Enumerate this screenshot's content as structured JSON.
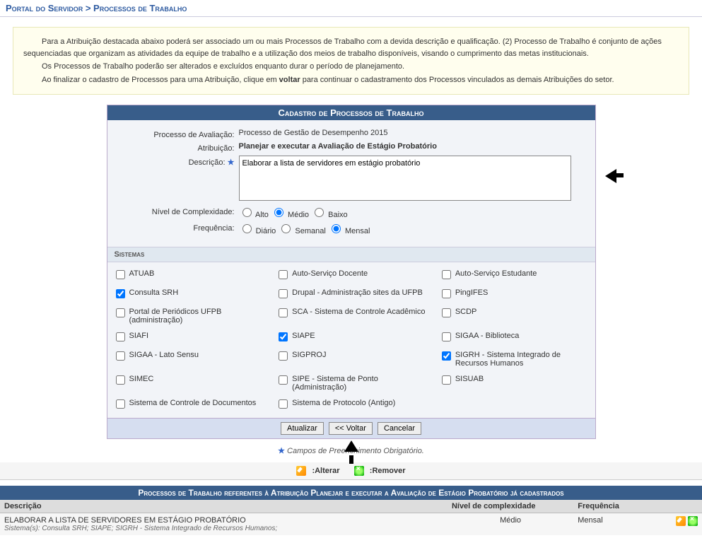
{
  "breadcrumb": "Portal do Servidor > Processos de Trabalho",
  "info": {
    "p1": "Para a Atribuição destacada abaixo poderá ser associado um ou mais Processos de Trabalho com a devida descrição e qualificação. (2) Processo de Trabalho é conjunto de ações sequenciadas que organizam as atividades da equipe de trabalho e a utilização dos meios de trabalho disponíveis, visando o cumprimento das metas institucionais.",
    "p2": "Os Processos de Trabalho poderão ser alterados e excluídos enquanto durar o período de planejamento.",
    "p3_pre": "Ao finalizar o cadastro de Processos para uma Atribuição, clique em ",
    "p3_bold": "voltar",
    "p3_post": " para continuar o cadastramento dos Processos vinculados as demais Atribuições do setor."
  },
  "panel_title": "Cadastro de Processos de Trabalho",
  "labels": {
    "processo": "Processo de Avaliação:",
    "atribuicao": "Atribuição:",
    "descricao": "Descrição:",
    "nivel": "Nível de Complexidade:",
    "frequencia": "Frequência:"
  },
  "values": {
    "processo": "Processo de Gestão de Desempenho 2015",
    "atribuicao": "Planejar e executar a Avaliação de Estágio Probatório",
    "descricao": "Elaborar a lista de servidores em estágio probatório"
  },
  "nivel_opts": {
    "alto": "Alto",
    "medio": "Médio",
    "baixo": "Baixo",
    "selected": "medio"
  },
  "freq_opts": {
    "diario": "Diário",
    "semanal": "Semanal",
    "mensal": "Mensal",
    "selected": "mensal"
  },
  "sistemas_hdr": "Sistemas",
  "sistemas": [
    {
      "label": "ATUAB",
      "checked": false
    },
    {
      "label": "Auto-Serviço Docente",
      "checked": false
    },
    {
      "label": "Auto-Serviço Estudante",
      "checked": false
    },
    {
      "label": "Consulta SRH",
      "checked": true
    },
    {
      "label": "Drupal - Administração sites da UFPB",
      "checked": false
    },
    {
      "label": "PingIFES",
      "checked": false
    },
    {
      "label": "Portal de Periódicos UFPB (administração)",
      "checked": false
    },
    {
      "label": "SCA - Sistema de Controle Acadêmico",
      "checked": false
    },
    {
      "label": "SCDP",
      "checked": false
    },
    {
      "label": "SIAFI",
      "checked": false
    },
    {
      "label": "SIAPE",
      "checked": true
    },
    {
      "label": "SIGAA - Biblioteca",
      "checked": false
    },
    {
      "label": "SIGAA - Lato Sensu",
      "checked": false
    },
    {
      "label": "SIGPROJ",
      "checked": false
    },
    {
      "label": "SIGRH - Sistema Integrado de Recursos Humanos",
      "checked": true
    },
    {
      "label": "SIMEC",
      "checked": false
    },
    {
      "label": "SIPE - Sistema de Ponto (Administração)",
      "checked": false
    },
    {
      "label": "SISUAB",
      "checked": false
    },
    {
      "label": "Sistema de Controle de Documentos",
      "checked": false
    },
    {
      "label": "Sistema de Protocolo (Antigo)",
      "checked": false
    }
  ],
  "buttons": {
    "atualizar": "Atualizar",
    "voltar": "<< Voltar",
    "cancelar": "Cancelar"
  },
  "required_note": "Campos de Preenchimento Obrigatório.",
  "legend": {
    "alterar": ":Alterar",
    "remover": ":Remover"
  },
  "table_title": "Processos de Trabalho referentes à Atribuição Planejar e executar a Avaliação de Estágio Probatório já cadastrados",
  "table_headers": {
    "descricao": "Descrição",
    "nivel": "Nível de complexidade",
    "freq": "Frequência"
  },
  "table_rows": [
    {
      "descricao": "ELABORAR A LISTA DE SERVIDORES EM ESTÁGIO PROBATÓRIO",
      "sistemas": "Sistema(s):  Consulta SRH;  SIAPE;  SIGRH - Sistema Integrado de Recursos Humanos;",
      "nivel": "Médio",
      "freq": "Mensal"
    }
  ]
}
